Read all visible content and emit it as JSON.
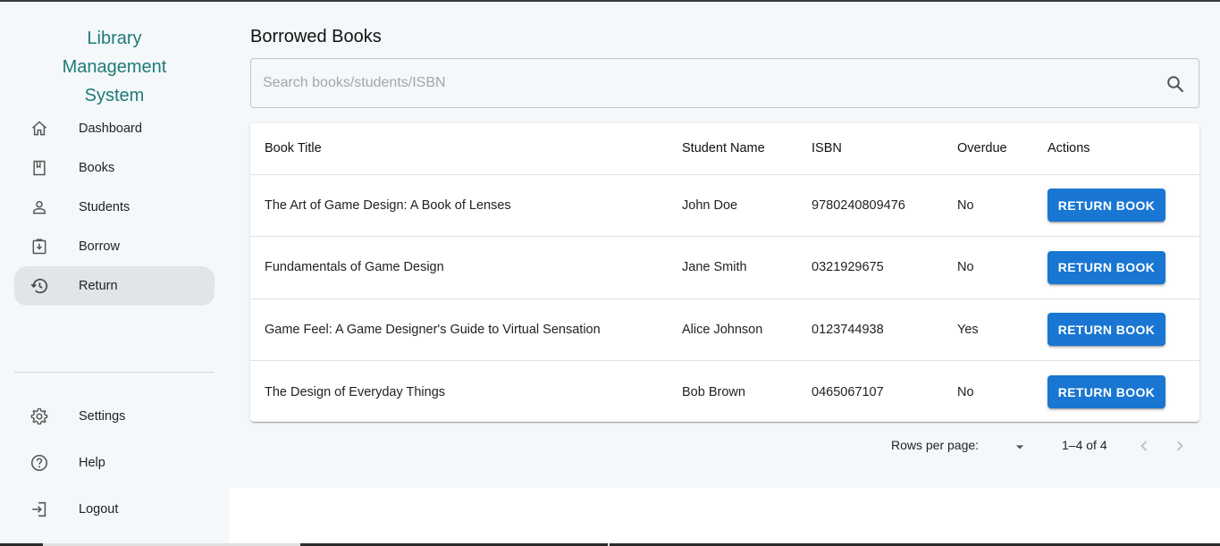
{
  "app": {
    "title": "Library Management System"
  },
  "sidebar": {
    "items": [
      {
        "label": "Dashboard",
        "icon": "home-icon"
      },
      {
        "label": "Books",
        "icon": "book-icon"
      },
      {
        "label": "Students",
        "icon": "person-icon"
      },
      {
        "label": "Borrow",
        "icon": "borrow-icon"
      },
      {
        "label": "Return",
        "icon": "history-icon",
        "active": true
      }
    ],
    "bottom_items": [
      {
        "label": "Settings",
        "icon": "gear-icon"
      },
      {
        "label": "Help",
        "icon": "help-icon"
      },
      {
        "label": "Logout",
        "icon": "logout-icon"
      }
    ]
  },
  "main": {
    "title": "Borrowed Books",
    "search": {
      "placeholder": "Search books/students/ISBN",
      "value": ""
    },
    "table": {
      "columns": [
        "Book Title",
        "Student Name",
        "ISBN",
        "Overdue",
        "Actions"
      ],
      "rows": [
        {
          "title": "The Art of Game Design: A Book of Lenses",
          "student": "John Doe",
          "isbn": "9780240809476",
          "overdue": "No",
          "action": "RETURN BOOK"
        },
        {
          "title": "Fundamentals of Game Design",
          "student": "Jane Smith",
          "isbn": "0321929675",
          "overdue": "No",
          "action": "RETURN BOOK"
        },
        {
          "title": "Game Feel: A Game Designer's Guide to Virtual Sensation",
          "student": "Alice Johnson",
          "isbn": "0123744938",
          "overdue": "Yes",
          "action": "RETURN BOOK"
        },
        {
          "title": "The Design of Everyday Things",
          "student": "Bob Brown",
          "isbn": "0465067107",
          "overdue": "No",
          "action": "RETURN BOOK"
        }
      ]
    },
    "pagination": {
      "rows_per_page_label": "Rows per page:",
      "range": "1–4 of 4"
    }
  },
  "colors": {
    "accent": "#1976d2",
    "title": "#1f7a7a",
    "sidebar_bg": "#f4f8fa",
    "active_bg": "#e2e5e7"
  }
}
